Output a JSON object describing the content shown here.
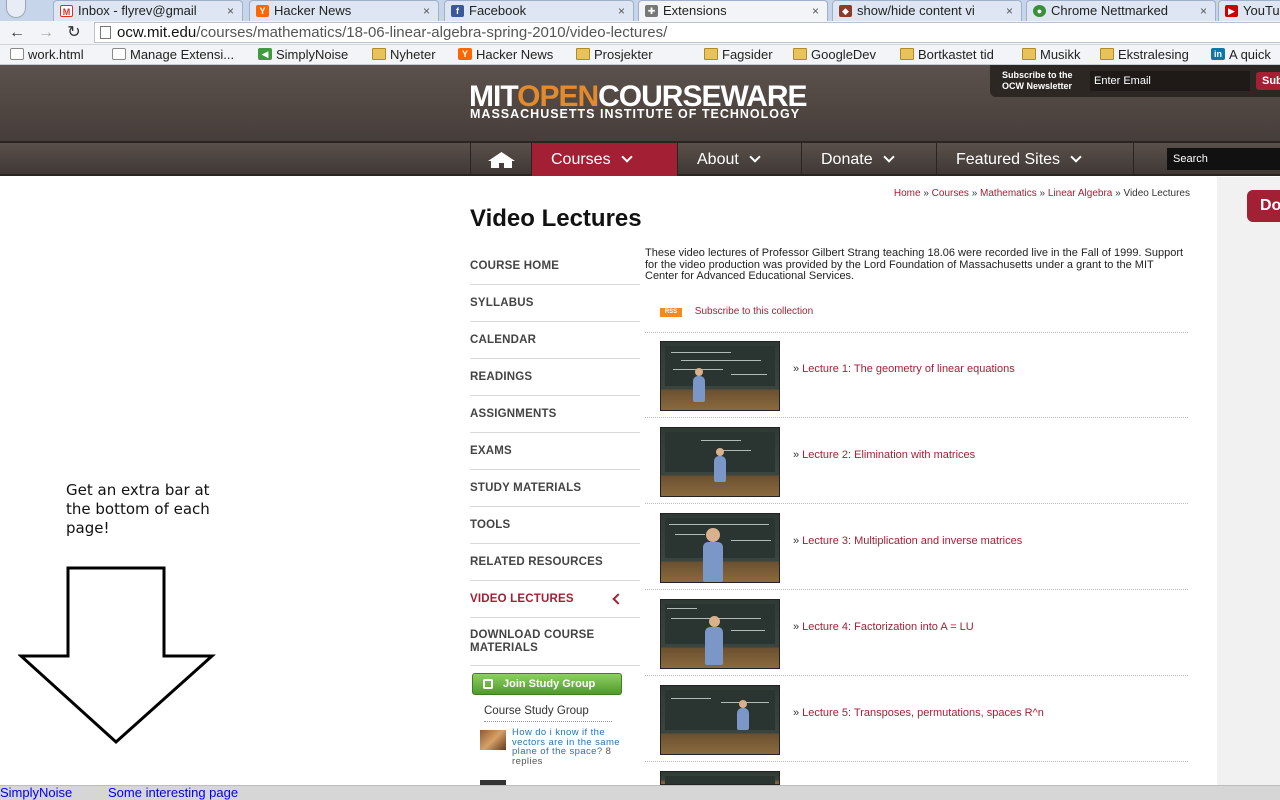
{
  "browser": {
    "tabs": [
      {
        "title": "Inbox - flyrev@gmail",
        "icon": "gmail-icon",
        "color": "#d93025"
      },
      {
        "title": "Hacker News",
        "icon": "hacker-news-icon",
        "color": "#ff6600"
      },
      {
        "title": "Facebook",
        "icon": "facebook-icon",
        "color": "#3b5998"
      },
      {
        "title": "Extensions",
        "icon": "puzzle-icon",
        "color": "#666666"
      },
      {
        "title": "show/hide content vi",
        "icon": "page-icon",
        "color": "#8a3b2a"
      },
      {
        "title": "Chrome Nettmarked",
        "icon": "chrome-icon",
        "color": "#3a8f3a"
      },
      {
        "title": "YouTu",
        "icon": "youtube-icon",
        "color": "#cc0000"
      }
    ],
    "url_prefix": "ocw.mit.edu",
    "url_path": "/courses/mathematics/18-06-linear-algebra-spring-2010/video-lectures/",
    "bookmarks": [
      {
        "label": "work.html",
        "icon": "page-icon"
      },
      {
        "label": "Manage Extensi...",
        "icon": "page-icon"
      },
      {
        "label": "SimplyNoise",
        "icon": "speaker-icon"
      },
      {
        "label": "Nyheter",
        "icon": "folder-icon"
      },
      {
        "label": "Hacker News",
        "icon": "hacker-news-icon"
      },
      {
        "label": "Prosjekter",
        "icon": "folder-icon"
      },
      {
        "label": "Fagsider",
        "icon": "folder-icon"
      },
      {
        "label": "GoogleDev",
        "icon": "folder-icon"
      },
      {
        "label": "Bortkastet tid",
        "icon": "folder-icon"
      },
      {
        "label": "Musikk",
        "icon": "folder-icon"
      },
      {
        "label": "Ekstralesing",
        "icon": "folder-icon"
      },
      {
        "label": "A quick",
        "icon": "linkedin-icon"
      }
    ]
  },
  "annotation": {
    "text": "Get an extra bar at the bottom of each page!"
  },
  "header": {
    "logo_mit": "MIT",
    "logo_open": "OPEN",
    "logo_courseware": "COURSEWARE",
    "logo_subtitle": "MASSACHUSETTS INSTITUTE OF TECHNOLOGY",
    "newsletter_label": "Subscribe to the OCW Newsletter",
    "newsletter_placeholder": "Enter Email",
    "newsletter_button": "Sub"
  },
  "nav": {
    "items": [
      "Courses",
      "About",
      "Donate",
      "Featured Sites"
    ],
    "search_placeholder": "Search"
  },
  "breadcrumb": {
    "items": [
      "Home",
      "Courses",
      "Mathematics",
      "Linear Algebra"
    ],
    "current": "Video Lectures",
    "separator": "»"
  },
  "page": {
    "title": "Video Lectures",
    "donate_tab": "Do",
    "intro": "These video lectures of Professor Gilbert Strang teaching 18.06 were recorded live in the Fall of 1999. Support for the video production was provided by the Lord Foundation of Massachusetts under a grant to the MIT Center for Advanced Educational Services.",
    "rss_badge": "RSS",
    "rss_link": "Subscribe to this collection"
  },
  "course_nav": [
    "COURSE HOME",
    "SYLLABUS",
    "CALENDAR",
    "READINGS",
    "ASSIGNMENTS",
    "EXAMS",
    "STUDY MATERIALS",
    "TOOLS",
    "RELATED RESOURCES",
    "VIDEO LECTURES",
    "DOWNLOAD COURSE MATERIALS"
  ],
  "study_group": {
    "button": "Join Study Group",
    "title": "Course Study Group",
    "post_text": "How do i know if the vectors are in the same plane of the space?",
    "post_replies": "8 replies"
  },
  "lectures": [
    "Lecture 1: The geometry of linear equations",
    "Lecture 2: Elimination with matrices",
    "Lecture 3: Multiplication and inverse matrices",
    "Lecture 4: Factorization into A = LU",
    "Lecture 5: Transposes, permutations, spaces R^n"
  ],
  "extension_bar": {
    "links": [
      "SimplyNoise",
      "Some interesting page"
    ]
  },
  "colors": {
    "mit_red": "#a31f34",
    "ocw_orange": "#e38a2c",
    "header_bg": "#4f4642",
    "study_green": "#5aa632",
    "link_blue": "#0000ee"
  }
}
